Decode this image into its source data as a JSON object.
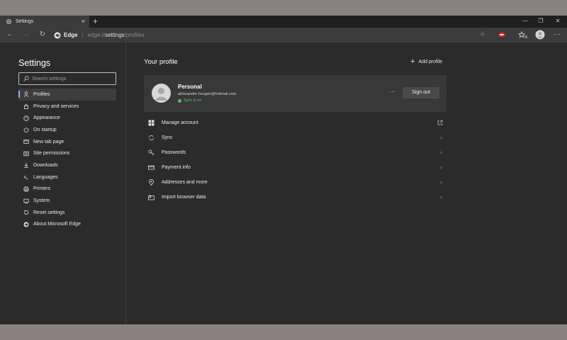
{
  "tab": {
    "title": "Settings",
    "close": "×",
    "new_tab": "+"
  },
  "window": {
    "minimize": "—",
    "restore": "❐",
    "close": "✕"
  },
  "address": {
    "site_label": "Edge",
    "separator": "|",
    "url_scheme": "edge://",
    "url_path": "settings",
    "url_rest": "/profiles"
  },
  "sidebar": {
    "title": "Settings",
    "search_placeholder": "Search settings",
    "items": [
      {
        "label": "Profiles",
        "icon": "person-icon",
        "active": true
      },
      {
        "label": "Privacy and services",
        "icon": "lock-icon"
      },
      {
        "label": "Appearance",
        "icon": "palette-icon"
      },
      {
        "label": "On startup",
        "icon": "power-icon"
      },
      {
        "label": "New tab page",
        "icon": "newtab-icon"
      },
      {
        "label": "Site permissions",
        "icon": "site-permissions-icon"
      },
      {
        "label": "Downloads",
        "icon": "download-icon"
      },
      {
        "label": "Languages",
        "icon": "language-icon"
      },
      {
        "label": "Printers",
        "icon": "printer-icon"
      },
      {
        "label": "System",
        "icon": "system-icon"
      },
      {
        "label": "Reset settings",
        "icon": "reset-icon"
      },
      {
        "label": "About Microsoft Edge",
        "icon": "edge-icon"
      }
    ]
  },
  "main": {
    "title": "Your profile",
    "add_profile": "Add profile",
    "profile": {
      "name": "Personal",
      "email": "aleksander-hougen@hotmail.com",
      "sync_status": "Sync is on",
      "more": "···",
      "sign_out": "Sign out"
    },
    "rows": [
      {
        "label": "Manage account",
        "icon": "windows-icon",
        "trailing": "external"
      },
      {
        "label": "Sync",
        "icon": "sync-icon",
        "trailing": "chevron"
      },
      {
        "label": "Passwords",
        "icon": "key-icon",
        "trailing": "chevron"
      },
      {
        "label": "Payment info",
        "icon": "card-icon",
        "trailing": "chevron"
      },
      {
        "label": "Addresses and more",
        "icon": "location-icon",
        "trailing": "chevron"
      },
      {
        "label": "Import browser data",
        "icon": "import-icon",
        "trailing": "chevron"
      }
    ]
  },
  "colors": {
    "accent": "#8ab4f8",
    "sync_green": "#5cb85c",
    "background": "#2b2b2b",
    "card": "#383838"
  }
}
